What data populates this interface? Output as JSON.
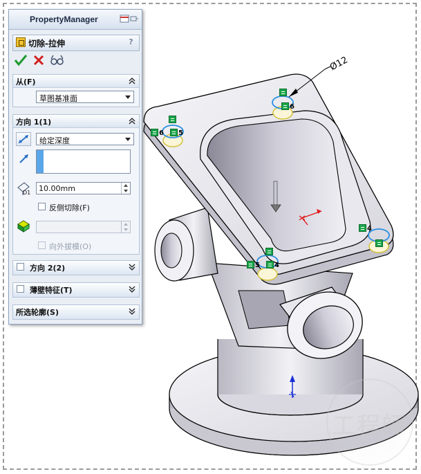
{
  "property_manager": {
    "title": "PropertyManager",
    "feature_name": "切除-拉伸",
    "help_glyph": "?",
    "actions": [
      "ok-checkmark-icon",
      "cancel-x-icon",
      "preview-glasses-icon"
    ]
  },
  "from_section": {
    "label": "从(F)",
    "start_condition": "草图基准面"
  },
  "direction1": {
    "label": "方向 1(1)",
    "end_condition": "给定深度",
    "depth_value": "10.00mm",
    "depth_icon_label": "D1",
    "flip_side_label": "反侧切除(F)",
    "draft_outward_label": "向外拔模(O)",
    "draft_value": ""
  },
  "direction2": {
    "label": "方向 2(2)"
  },
  "thin_feature": {
    "label": "薄壁特征(T)"
  },
  "selected_contours": {
    "label": "所选轮廓(S)"
  },
  "graphics": {
    "dimension_text": "Ø12",
    "marker_labels": [
      "6",
      "6",
      "5",
      "5",
      "4",
      "4"
    ],
    "watermark": "工程師"
  },
  "colors": {
    "accent_blue": "#5aa6e8",
    "confirm_green": "#1f9a2e",
    "cancel_red": "#d11f1f",
    "marker_green": "#1aa64a"
  }
}
